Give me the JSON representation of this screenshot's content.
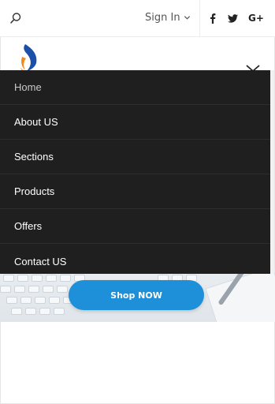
{
  "topbar": {
    "signin_label": "Sign In",
    "social": [
      {
        "icon": "facebook-icon",
        "glyph": "f"
      },
      {
        "icon": "twitter-icon",
        "glyph": "t"
      },
      {
        "icon": "google-plus-icon",
        "glyph": "G+"
      }
    ]
  },
  "menu": {
    "items": [
      {
        "label": "Home",
        "active": true
      },
      {
        "label": "About US",
        "active": false
      },
      {
        "label": "Sections",
        "active": false
      },
      {
        "label": "Products",
        "active": false
      },
      {
        "label": "Offers",
        "active": false
      },
      {
        "label": "Contact US",
        "active": false
      }
    ]
  },
  "hero": {
    "button_label": "Shop NOW"
  },
  "colors": {
    "menu_bg": "#1f1f1f",
    "accent": "#1e90d9",
    "logo_blue": "#1b4fa8",
    "logo_orange": "#f28a1e"
  }
}
